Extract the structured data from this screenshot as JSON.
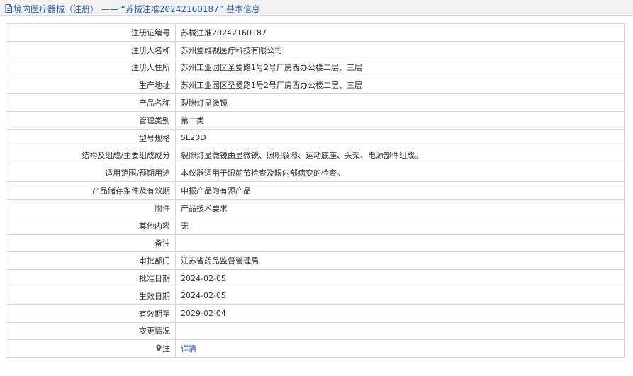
{
  "header": {
    "title": "境内医疗器械（注册） —— “苏械注准20242160187” 基本信息",
    "icon": "document-icon"
  },
  "rows": [
    {
      "label": "注册证编号",
      "value": "苏械注准20242160187"
    },
    {
      "label": "注册人名称",
      "value": "苏州爱维视医疗科技有限公司"
    },
    {
      "label": "注册人住所",
      "value": "苏州工业园区圣爱路1号2号厂房西办公楼二层、三层"
    },
    {
      "label": "生产地址",
      "value": "苏州工业园区圣爱路1号2号厂房西办公楼二层、三层"
    },
    {
      "label": "产品名称",
      "value": "裂隙灯显微镜"
    },
    {
      "label": "管理类别",
      "value": "第二类"
    },
    {
      "label": "型号规格",
      "value": "SL20D"
    },
    {
      "label": "结构及组成/主要组成成分",
      "value": "裂隙灯显微镜由显微镜、照明裂隙、运动底座、头架、电源部件组成。"
    },
    {
      "label": "适用范围/预期用途",
      "value": "本仪器适用于眼前节检查及眼内部病变的检查。"
    },
    {
      "label": "产品储存条件及有效期",
      "value": "申报产品为有源产品"
    },
    {
      "label": "附件",
      "value": "产品技术要求"
    },
    {
      "label": "其他内容",
      "value": "无"
    },
    {
      "label": "备注",
      "value": ""
    },
    {
      "label": "审批部门",
      "value": "江苏省药品监督管理局"
    },
    {
      "label": "批准日期",
      "value": "2024-02-05"
    },
    {
      "label": "生效日期",
      "value": "2024-02-05"
    },
    {
      "label": "有效期至",
      "value": "2029-02-04"
    },
    {
      "label": "变更情况",
      "value": ""
    }
  ],
  "note": {
    "label": "注",
    "icon": "pin-icon",
    "link": "详情"
  },
  "colors": {
    "link": "#2e5ea9",
    "border": "#d9d9d9",
    "header_bg": "#f2f2f2"
  }
}
